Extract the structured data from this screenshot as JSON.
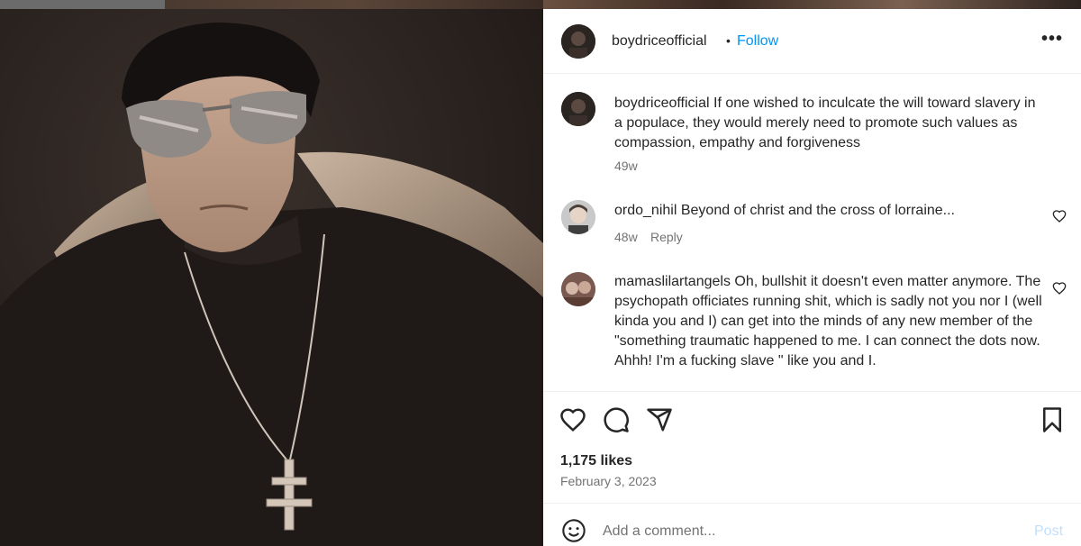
{
  "post": {
    "username": "boydriceofficial",
    "follow_label": "Follow",
    "dot": "•",
    "more_label": "•••",
    "caption": {
      "username": "boydriceofficial",
      "text": "If one wished to inculcate the will toward slavery in a populace, they would merely need to promote such values as compassion, empathy and forgiveness",
      "time": "49w"
    },
    "comments": [
      {
        "username": "ordo_nihil",
        "text": "Beyond of christ and the cross of lorraine...",
        "time": "48w",
        "reply_label": "Reply"
      },
      {
        "username": "mamaslilartangels",
        "text": "Oh, bullshit it doesn't even matter anymore. The psychopath officiates running shit, which is sadly not you nor I (well kinda you and I) can get into the minds of any new member of the \"something traumatic happened to me. I can connect the dots now. Ahhh! I'm a fucking slave \" like you and I."
      }
    ],
    "likes": "1,175 likes",
    "date": "February 3, 2023",
    "add_comment_placeholder": "Add a comment...",
    "post_label": "Post"
  },
  "icons": [
    "heart-icon",
    "comment-icon",
    "share-icon",
    "bookmark-icon",
    "emoji-icon",
    "more-icon"
  ],
  "colors": {
    "link": "#0095f6",
    "text": "#262626",
    "muted": "#737373",
    "post_disabled": "#c0dffd"
  }
}
